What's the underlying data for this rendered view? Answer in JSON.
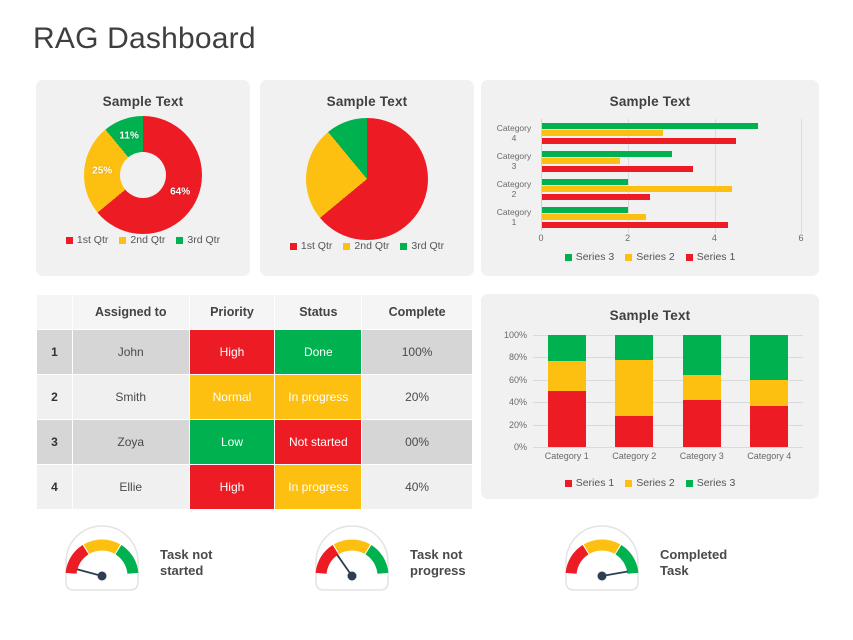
{
  "page": {
    "title": "RAG Dashboard"
  },
  "colors": {
    "red": "#ed1c24",
    "yellow": "#fdc010",
    "green": "#00b14f",
    "card_bg": "#f1f1f1",
    "page_bg": "#ffffff",
    "text": "#4a4a4a"
  },
  "chart_data": [
    {
      "id": "donut",
      "type": "pie",
      "title": "Sample Text",
      "donut": true,
      "categories": [
        "1st Qtr",
        "2nd Qtr",
        "3rd Qtr"
      ],
      "values": [
        64,
        25,
        11
      ],
      "data_labels": [
        "64%",
        "25%",
        "11%"
      ],
      "colors": [
        "#ed1c24",
        "#fdc010",
        "#00b14f"
      ],
      "legend": [
        "1st Qtr",
        "2nd Qtr",
        "3rd Qtr"
      ],
      "legend_position": "bottom"
    },
    {
      "id": "pie",
      "type": "pie",
      "title": "Sample Text",
      "donut": false,
      "categories": [
        "1st Qtr",
        "2nd Qtr",
        "3rd Qtr"
      ],
      "values": [
        64,
        25,
        11
      ],
      "data_labels": [],
      "colors": [
        "#ed1c24",
        "#fdc010",
        "#00b14f"
      ],
      "legend": [
        "1st Qtr",
        "2nd Qtr",
        "3rd Qtr"
      ],
      "legend_position": "bottom"
    },
    {
      "id": "hbar",
      "type": "bar",
      "orientation": "horizontal",
      "title": "Sample Text",
      "categories": [
        "Category 1",
        "Category 2",
        "Category 3",
        "Category 4"
      ],
      "series": [
        {
          "name": "Series 1",
          "color": "#ed1c24",
          "values": [
            4.3,
            2.5,
            3.5,
            4.5
          ]
        },
        {
          "name": "Series 2",
          "color": "#fdc010",
          "values": [
            2.4,
            4.4,
            1.8,
            2.8
          ]
        },
        {
          "name": "Series 3",
          "color": "#00b14f",
          "values": [
            2.0,
            2.0,
            3.0,
            5.0
          ]
        }
      ],
      "xlim": [
        0,
        6
      ],
      "xticks": [
        0,
        2,
        4,
        6
      ],
      "xtick_labels": [
        "0",
        "2",
        "4",
        "6"
      ],
      "xlabel": "",
      "ylabel": "",
      "grid": true,
      "legend": [
        "Series 3",
        "Series 2",
        "Series 1"
      ],
      "legend_colors": [
        "#00b14f",
        "#fdc010",
        "#ed1c24"
      ],
      "legend_position": "bottom"
    },
    {
      "id": "stacked",
      "type": "bar",
      "stacked": true,
      "orientation": "vertical",
      "title": "Sample Text",
      "categories": [
        "Category 1",
        "Category 2",
        "Category 3",
        "Category 4"
      ],
      "series": [
        {
          "name": "Series 1",
          "color": "#ed1c24",
          "values": [
            50,
            28,
            42,
            37
          ]
        },
        {
          "name": "Series 2",
          "color": "#fdc010",
          "values": [
            27,
            50,
            22,
            23
          ]
        },
        {
          "name": "Series 3",
          "color": "#00b14f",
          "values": [
            23,
            22,
            36,
            40
          ]
        }
      ],
      "ylim": [
        0,
        100
      ],
      "yticks": [
        0,
        20,
        40,
        60,
        80,
        100
      ],
      "ytick_labels": [
        "0%",
        "20%",
        "40%",
        "60%",
        "80%",
        "100%"
      ],
      "xlabel": "",
      "ylabel": "",
      "grid": true,
      "legend": [
        "Series 1",
        "Series 2",
        "Series 3"
      ],
      "legend_colors": [
        "#ed1c24",
        "#fdc010",
        "#00b14f"
      ],
      "legend_position": "bottom"
    }
  ],
  "table": {
    "headers": [
      "",
      "Assigned to",
      "Priority",
      "Status",
      "Complete"
    ],
    "rows": [
      {
        "index": "1",
        "assigned_to": "John",
        "priority": "High",
        "priority_color": "red",
        "status": "Done",
        "status_color": "green",
        "complete": "100%"
      },
      {
        "index": "2",
        "assigned_to": "Smith",
        "priority": "Normal",
        "priority_color": "yellow",
        "status": "In progress",
        "status_color": "yellow",
        "complete": "20%"
      },
      {
        "index": "3",
        "assigned_to": "Zoya",
        "priority": "Low",
        "priority_color": "green",
        "status": "Not started",
        "status_color": "red",
        "complete": "00%"
      },
      {
        "index": "4",
        "assigned_to": "Ellie",
        "priority": "High",
        "priority_color": "red",
        "status": "In progress",
        "status_color": "yellow",
        "complete": "40%"
      }
    ]
  },
  "gauges": [
    {
      "label": "Task not\nstarted",
      "needle_angle": -165,
      "icon": "gauge-icon"
    },
    {
      "label": "Task not\nprogress",
      "needle_angle": -125,
      "icon": "gauge-icon"
    },
    {
      "label": "Completed\nTask",
      "needle_angle": -10,
      "icon": "gauge-icon"
    }
  ]
}
